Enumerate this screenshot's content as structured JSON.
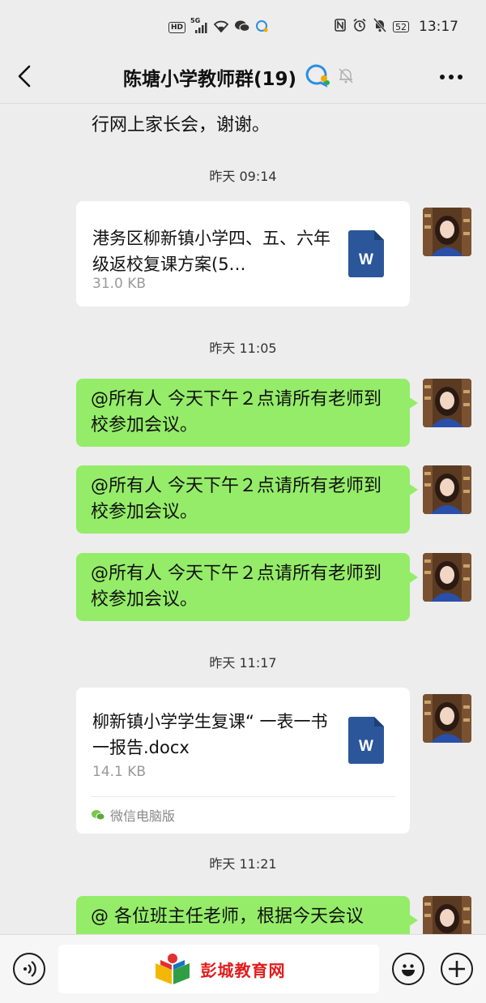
{
  "status_bar": {
    "hd": "HD",
    "network": "5G",
    "battery": "52",
    "time": "13:17"
  },
  "header": {
    "title": "陈塘小学教师群(19)"
  },
  "messages": {
    "partial_text": "行网上家长会，谢谢。",
    "ts1": "昨天 09:14",
    "file1": {
      "name": "港务区柳新镇小学四、五、六年级返校复课方案(5…",
      "size": "31.0 KB"
    },
    "ts2": "昨天 11:05",
    "text1": "@所有人  今天下午２点请所有老师到校参加会议。",
    "text2": "@所有人  今天下午２点请所有老师到校参加会议。",
    "text3": "@所有人  今天下午２点请所有老师到校参加会议。",
    "ts3": "昨天 11:17",
    "file2": {
      "name": "柳新镇小学学生复课“ 一表一书一报告.docx",
      "size": "14.1 KB",
      "source": "微信电脑版"
    },
    "ts4": "昨天 11:21",
    "text4": "@ 各位班主任老师，根据今天会议"
  },
  "bottom_bar": {
    "watermark": "彭城教育网"
  },
  "colors": {
    "bubble_green": "#95ec69",
    "background": "#ededed",
    "word_blue": "#2b579a",
    "watermark_red": "#e31b1b"
  }
}
